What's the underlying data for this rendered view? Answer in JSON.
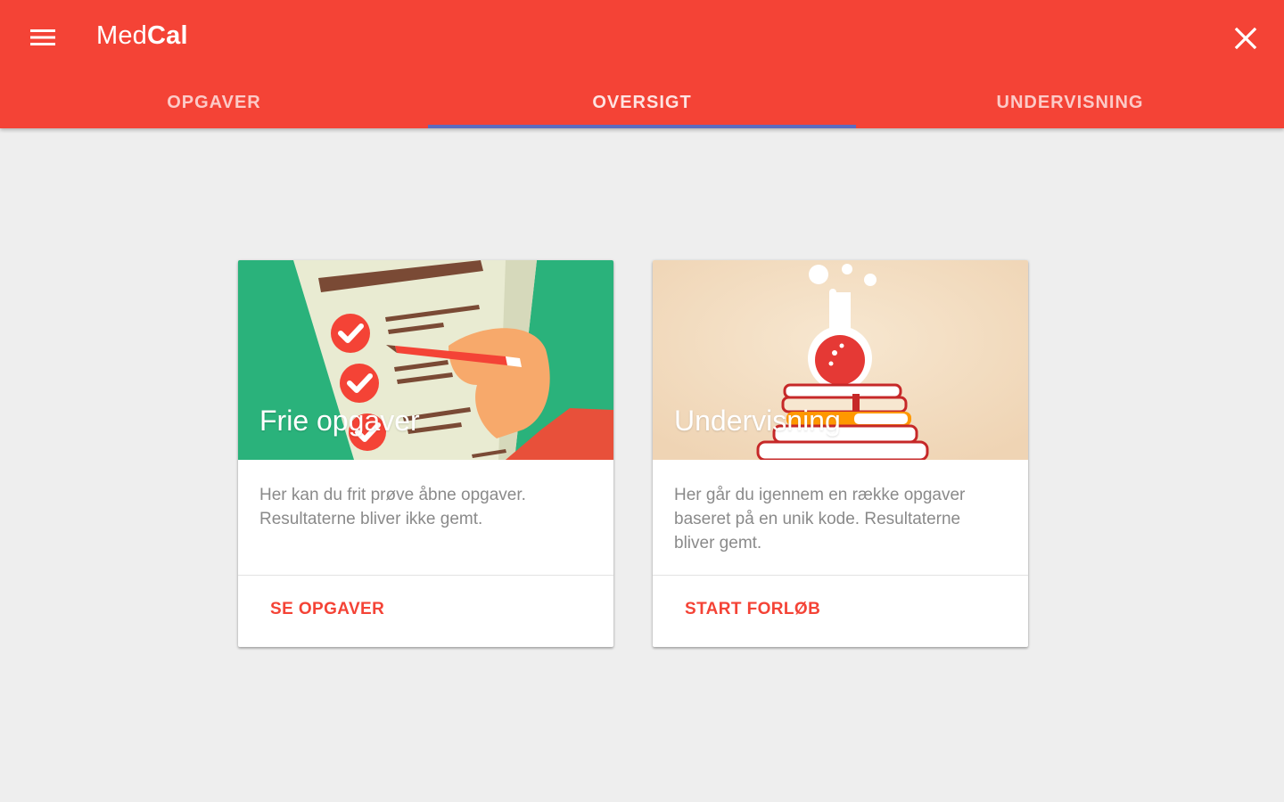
{
  "app": {
    "title_regular": "Med",
    "title_bold": "Cal"
  },
  "tabs": [
    {
      "label": "OPGAVER",
      "active": false
    },
    {
      "label": "OVERSIGT",
      "active": true
    },
    {
      "label": "UNDERVISNING",
      "active": false
    }
  ],
  "cards": [
    {
      "media_title": "Frie opgaver",
      "text": "Her kan du frit prøve åbne opgaver. Resultaterne bliver ikke gemt.",
      "action": "SE OPGAVER",
      "illustration": "checklist-illustration"
    },
    {
      "media_title": "Undervisning",
      "text": "Her går du igennem en række opgaver baseret på en unik kode. Resultaterne bliver gemt.",
      "action": "START FORLØB",
      "illustration": "flask-books-illustration"
    }
  ],
  "icons": {
    "menu": "menu-icon",
    "close": "close-icon"
  },
  "colors": {
    "primary": "#f44336",
    "tab_indicator": "#5c6bc0",
    "background": "#eeeeee",
    "card_1_media": "#2ab27b",
    "card_2_media": "#f3dcc0"
  }
}
